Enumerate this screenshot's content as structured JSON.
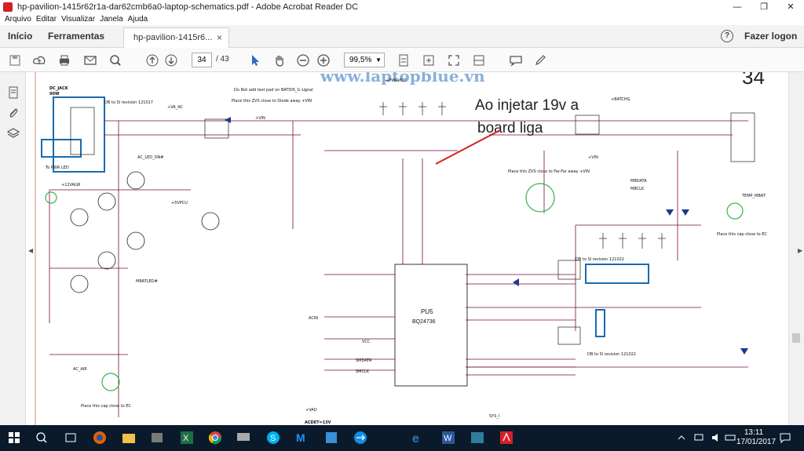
{
  "window": {
    "title": "hp-pavilion-1415r62r1a-dar62cmb6a0-laptop-schematics.pdf - Adobe Acrobat Reader DC",
    "minimize": "—",
    "restore": "❐",
    "close": "✕"
  },
  "menu": [
    "Arquivo",
    "Editar",
    "Visualizar",
    "Janela",
    "Ajuda"
  ],
  "tabs": {
    "home": "Início",
    "tools": "Ferramentas",
    "document": "hp-pavilion-1415r6...",
    "close_tab": "×",
    "help": "?",
    "login": "Fazer logon"
  },
  "toolbar": {
    "current_page": "34",
    "total_pages": "/ 43",
    "zoom": "99,5%",
    "icons": [
      "save-icon",
      "upload-icon",
      "print-icon",
      "mail-icon",
      "search-icon",
      "page-up-icon",
      "page-down-icon",
      "cursor-icon",
      "hand-icon",
      "zoom-out-icon",
      "zoom-in-icon",
      "fit-icon",
      "comment-icon",
      "pen-icon"
    ]
  },
  "left_panel": [
    "page-thumbnails-icon",
    "attachments-icon",
    "layers-icon"
  ],
  "schematic": {
    "page_number": "34",
    "watermark": "www.laptopblue.vn",
    "annotation_lines": [
      "Ao injetar 19v a",
      "board liga"
    ],
    "labels": {
      "dc_jack": "DC_JACK",
      "dc_jack_power": "90W",
      "db_si_1": "DB to SI revision 121017",
      "db_si_2": "DB to SI revision 121022",
      "db_si_3": "DB to SI revision 121022",
      "to_pwr_led": "To PWR LED",
      "warn": "Do Not add test pad on BATDIS_G signal",
      "zvs_1": "Place this ZVS close to Diode away +VIN",
      "zvs_2": "Place this ZVS close to Far-Far away +VIN",
      "cap_ec_1": "Place this cap close to EC",
      "cap_ec_2": "Place this cap close to EC",
      "pu5": "PU5",
      "bq": "BQ24736",
      "acdet": "ACDET=13V",
      "vadp": "+VA_AC",
      "vad": "+VAD",
      "batchg": "+BATCHG",
      "vin": "+VIN",
      "ac_led_on": "AC_LED_ON#",
      "mbatled": "MBATLED#",
      "ac_air": "AC_AIR",
      "temp_mbat": "TEMP_MBAT",
      "mbdata": "MBDATA",
      "mbclk": "MBCLK",
      "valw": "+12VALW",
      "pcu": "+5VPCU",
      "pu_vin": "+VIN",
      "pwrvdd": "+PWRVDD",
      "acin": "ACIN",
      "smdata": "SMDATA",
      "smclk": "SMCLK",
      "sys_i": "SYS_I",
      "vcc": "VCC"
    }
  },
  "taskbar": {
    "icons": [
      "windows-start-icon",
      "search-icon",
      "task-view-icon",
      "firefox-icon",
      "files-icon",
      "excel-icon",
      "chrome-icon",
      "skype-icon",
      "m-icon",
      "teamviewer-icon",
      "edge-icon",
      "word-icon",
      "app-icon",
      "acrobat-icon"
    ],
    "time": "13:11",
    "date": "17/01/2017"
  },
  "colors": {
    "accent": "#d32027",
    "taskbar": "#0b1a2a",
    "schematic_wire": "#7a0a3a",
    "schematic_box": "#1a6bb0"
  }
}
